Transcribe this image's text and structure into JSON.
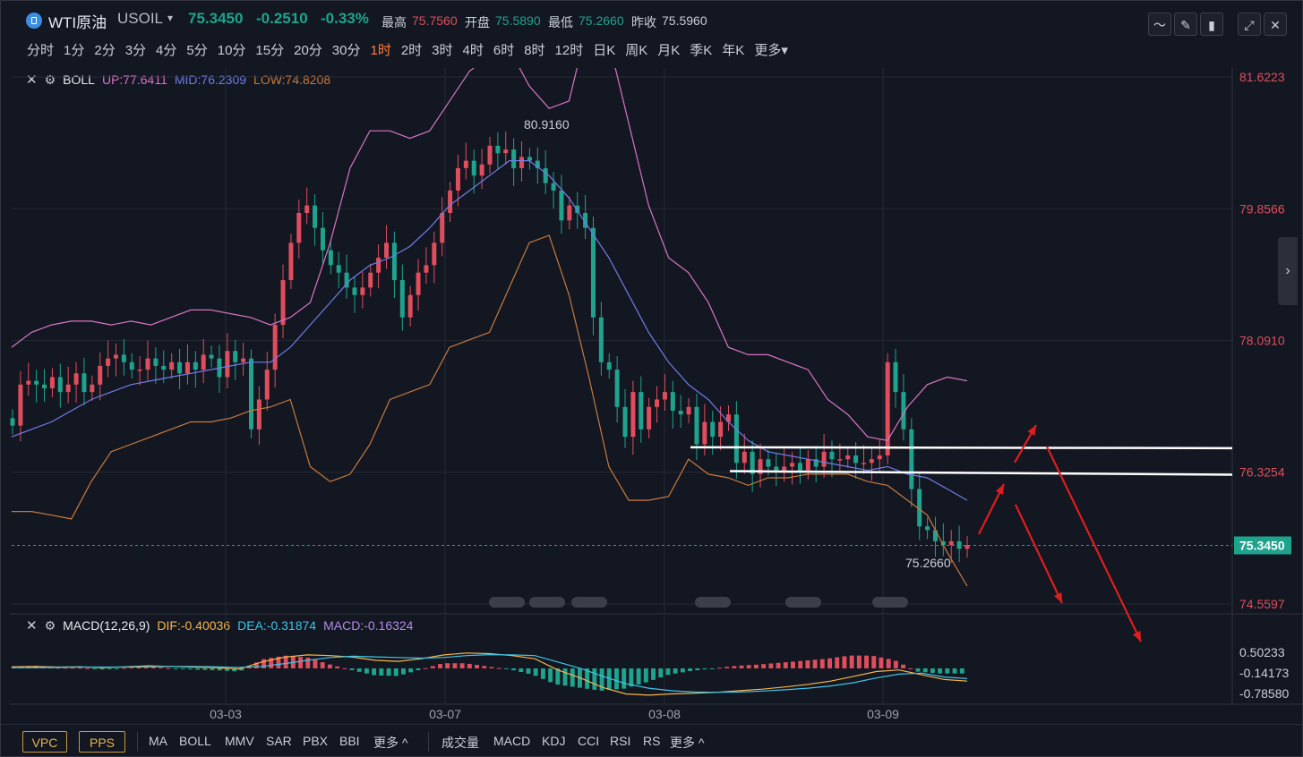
{
  "header": {
    "symbol_name": "WTI原油",
    "symbol_code": "USOIL",
    "price": "75.3450",
    "change": "-0.2510",
    "change_pct": "-0.33%",
    "high_label": "最高",
    "high": "75.7560",
    "open_label": "开盘",
    "open": "75.5890",
    "low_label": "最低",
    "low": "75.2660",
    "prev_label": "昨收",
    "prev": "75.5960"
  },
  "periods": [
    "分时",
    "1分",
    "2分",
    "3分",
    "4分",
    "5分",
    "10分",
    "15分",
    "20分",
    "30分",
    "1时",
    "2时",
    "3时",
    "4时",
    "6时",
    "8时",
    "12时",
    "日K",
    "周K",
    "月K",
    "季K",
    "年K",
    "更多"
  ],
  "active_period": "1时",
  "boll_legend": {
    "name": "BOLL",
    "up": "UP:77.6411",
    "mid": "MID:76.2309",
    "low": "LOW:74.8208"
  },
  "macd_legend": {
    "name": "MACD(12,26,9)",
    "dif": "DIF:-0.40036",
    "dea": "DEA:-0.31874",
    "macd": "MACD:-0.16324"
  },
  "colors": {
    "up": "#e04d5c",
    "down": "#1fa38d",
    "boll_up": "#d774c4",
    "boll_mid": "#6f7de6",
    "boll_low": "#c87a3c",
    "dif": "#f5b54a",
    "dea": "#3fc4e6",
    "price_tag": "#1fa38d",
    "background": "#131722",
    "grid": "#232833"
  },
  "price_axis": [
    "81.6223",
    "79.8566",
    "78.0910",
    "76.3254",
    "74.5597"
  ],
  "price_tag": "75.3450",
  "macd_axis": [
    "0.50233",
    "-0.14173",
    "-0.78580"
  ],
  "date_labels": [
    "03-03",
    "03-07",
    "03-08",
    "03-09"
  ],
  "annotations": {
    "high_label": "80.9160",
    "low_label": "75.2660"
  },
  "bottom": {
    "buttons": [
      "VPC",
      "PPS"
    ],
    "main_indicators": [
      "MA",
      "BOLL",
      "MMV",
      "SAR",
      "PBX",
      "BBI"
    ],
    "more1": "更多",
    "sub_indicators": [
      "成交量",
      "MACD",
      "KDJ",
      "CCI",
      "RSI",
      "RS"
    ],
    "more2": "更多"
  },
  "chart_data": {
    "type": "candlestick",
    "timeframe": "1时",
    "y_axis_range": [
      74.5597,
      81.6223
    ],
    "close_values": [
      76.95,
      77.5,
      77.55,
      77.5,
      77.45,
      77.6,
      77.4,
      77.5,
      77.65,
      77.4,
      77.5,
      77.75,
      77.85,
      77.9,
      77.8,
      77.7,
      77.7,
      77.85,
      77.75,
      77.7,
      77.8,
      77.65,
      77.8,
      77.7,
      77.9,
      77.85,
      77.6,
      77.95,
      77.8,
      77.85,
      76.9,
      77.3,
      77.7,
      78.3,
      78.9,
      79.4,
      79.8,
      79.9,
      79.6,
      79.3,
      79.1,
      79.0,
      78.8,
      78.7,
      78.8,
      79.0,
      79.2,
      79.4,
      78.9,
      78.4,
      78.7,
      79.0,
      79.1,
      79.4,
      79.8,
      80.1,
      80.4,
      80.5,
      80.3,
      80.45,
      80.7,
      80.6,
      80.65,
      80.4,
      80.55,
      80.5,
      80.4,
      80.2,
      80.1,
      79.7,
      79.9,
      79.8,
      79.6,
      78.4,
      77.8,
      77.7,
      77.2,
      76.8,
      77.4,
      76.9,
      77.2,
      77.3,
      77.4,
      77.15,
      77.1,
      77.2,
      76.7,
      77.0,
      76.8,
      77.0,
      77.1,
      76.45,
      76.6,
      76.3,
      76.5,
      76.4,
      76.35,
      76.4,
      76.45,
      76.35,
      76.5,
      76.4,
      76.6,
      76.5,
      76.5,
      76.55,
      76.45,
      76.45,
      76.5,
      76.55,
      77.8,
      77.4,
      76.9,
      76.1,
      75.6,
      75.55,
      75.4,
      75.35,
      75.4,
      75.3,
      75.35
    ],
    "boll_up": [
      78.0,
      78.2,
      78.3,
      78.35,
      78.35,
      78.3,
      78.35,
      78.3,
      78.4,
      78.5,
      78.5,
      78.45,
      78.4,
      78.3,
      78.4,
      78.6,
      79.4,
      80.4,
      80.9,
      80.9,
      80.8,
      80.9,
      81.3,
      81.7,
      81.9,
      82.0,
      81.5,
      81.2,
      81.3,
      82.4,
      82.1,
      81.0,
      79.9,
      79.2,
      79.0,
      78.6,
      78.0,
      77.9,
      77.9,
      77.8,
      77.7,
      77.3,
      77.1,
      76.8,
      76.75,
      77.2,
      77.5,
      77.6,
      77.55
    ],
    "boll_mid": [
      76.8,
      76.9,
      77.0,
      77.15,
      77.3,
      77.4,
      77.5,
      77.55,
      77.6,
      77.65,
      77.7,
      77.75,
      77.8,
      77.8,
      78.0,
      78.3,
      78.6,
      78.9,
      79.1,
      79.2,
      79.35,
      79.6,
      79.9,
      80.1,
      80.3,
      80.5,
      80.5,
      80.3,
      80.0,
      79.6,
      79.2,
      78.7,
      78.2,
      77.8,
      77.5,
      77.3,
      77.0,
      76.75,
      76.6,
      76.55,
      76.5,
      76.45,
      76.4,
      76.35,
      76.4,
      76.3,
      76.25,
      76.1,
      75.95
    ],
    "boll_low": [
      75.8,
      75.8,
      75.75,
      75.7,
      76.2,
      76.6,
      76.7,
      76.8,
      76.9,
      77.0,
      77.0,
      77.05,
      77.15,
      77.2,
      77.3,
      76.4,
      76.2,
      76.3,
      76.7,
      77.3,
      77.4,
      77.5,
      78.0,
      78.1,
      78.2,
      78.8,
      79.4,
      79.5,
      78.7,
      77.6,
      76.4,
      75.95,
      75.95,
      76.0,
      76.5,
      76.3,
      76.25,
      76.15,
      76.25,
      76.25,
      76.3,
      76.3,
      76.3,
      76.2,
      76.15,
      75.95,
      75.75,
      75.25,
      74.8
    ],
    "macd_dif": [
      0.05,
      0.06,
      0.04,
      0.05,
      0.02,
      0.05,
      0.08,
      0.06,
      0.04,
      0.02,
      -0.02,
      0.2,
      0.35,
      0.42,
      0.4,
      0.35,
      0.25,
      0.22,
      0.3,
      0.42,
      0.48,
      0.46,
      0.4,
      0.3,
      -0.05,
      -0.3,
      -0.6,
      -0.8,
      -0.84,
      -0.8,
      -0.78,
      -0.75,
      -0.7,
      -0.65,
      -0.58,
      -0.5,
      -0.4,
      -0.25,
      -0.1,
      -0.05,
      -0.2,
      -0.35,
      -0.4
    ],
    "macd_dea": [
      0.02,
      0.02,
      0.03,
      0.04,
      0.04,
      0.04,
      0.05,
      0.06,
      0.06,
      0.05,
      0.03,
      0.06,
      0.15,
      0.25,
      0.34,
      0.38,
      0.36,
      0.34,
      0.32,
      0.34,
      0.4,
      0.43,
      0.42,
      0.4,
      0.2,
      0.0,
      -0.25,
      -0.48,
      -0.62,
      -0.7,
      -0.74,
      -0.75,
      -0.74,
      -0.71,
      -0.67,
      -0.62,
      -0.55,
      -0.45,
      -0.3,
      -0.18,
      -0.15,
      -0.27,
      -0.32
    ]
  }
}
